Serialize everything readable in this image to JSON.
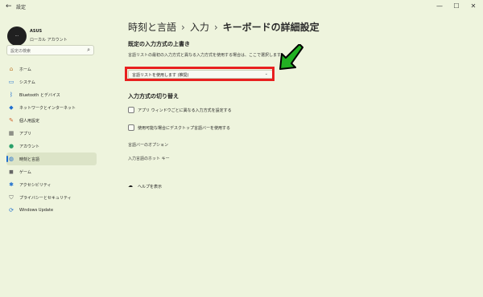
{
  "window": {
    "title": "設定"
  },
  "user": {
    "name": "ASUS",
    "account_type": "ローカル アカウント"
  },
  "search": {
    "placeholder": "設定の検索"
  },
  "nav": {
    "items": [
      {
        "label": "ホーム",
        "icon": "home-icon"
      },
      {
        "label": "システム",
        "icon": "monitor-icon"
      },
      {
        "label": "Bluetooth とデバイス",
        "icon": "bluetooth-icon"
      },
      {
        "label": "ネットワークとインターネット",
        "icon": "wifi-icon"
      },
      {
        "label": "個人用設定",
        "icon": "brush-icon"
      },
      {
        "label": "アプリ",
        "icon": "apps-icon"
      },
      {
        "label": "アカウント",
        "icon": "person-icon"
      },
      {
        "label": "時刻と言語",
        "icon": "globe-clock-icon",
        "selected": true
      },
      {
        "label": "ゲーム",
        "icon": "gamepad-icon"
      },
      {
        "label": "アクセシビリティ",
        "icon": "accessibility-icon"
      },
      {
        "label": "プライバシーとセキュリティ",
        "icon": "shield-icon"
      },
      {
        "label": "Windows Update",
        "icon": "update-icon"
      }
    ]
  },
  "breadcrumb": [
    "時刻と言語",
    "入力",
    "キーボードの詳細設定"
  ],
  "breadcrumb_separator": "›",
  "override": {
    "title": "既定の入力方式の上書き",
    "description": "言語リストの最初の入力方式と異なる入力方式を使用する場合は、ここで選択します",
    "dropdown_value": "言語リストを使用します (推奨)"
  },
  "switching": {
    "title": "入力方式の切り替え",
    "checkbox1": "アプリ ウィンドウごとに異なる入力方式を設定する",
    "checkbox2": "使用可能な場合にデスクトップ言語バーを使用する"
  },
  "links": {
    "language_bar": "言語バーのオプション",
    "hotkeys": "入力言語のホット キー"
  },
  "help": {
    "label": "ヘルプを表示"
  },
  "colors": {
    "background": "#eef4dd",
    "accent": "#1f6fcf",
    "highlight_red": "#e8201f",
    "arrow_green": "#22b022"
  }
}
